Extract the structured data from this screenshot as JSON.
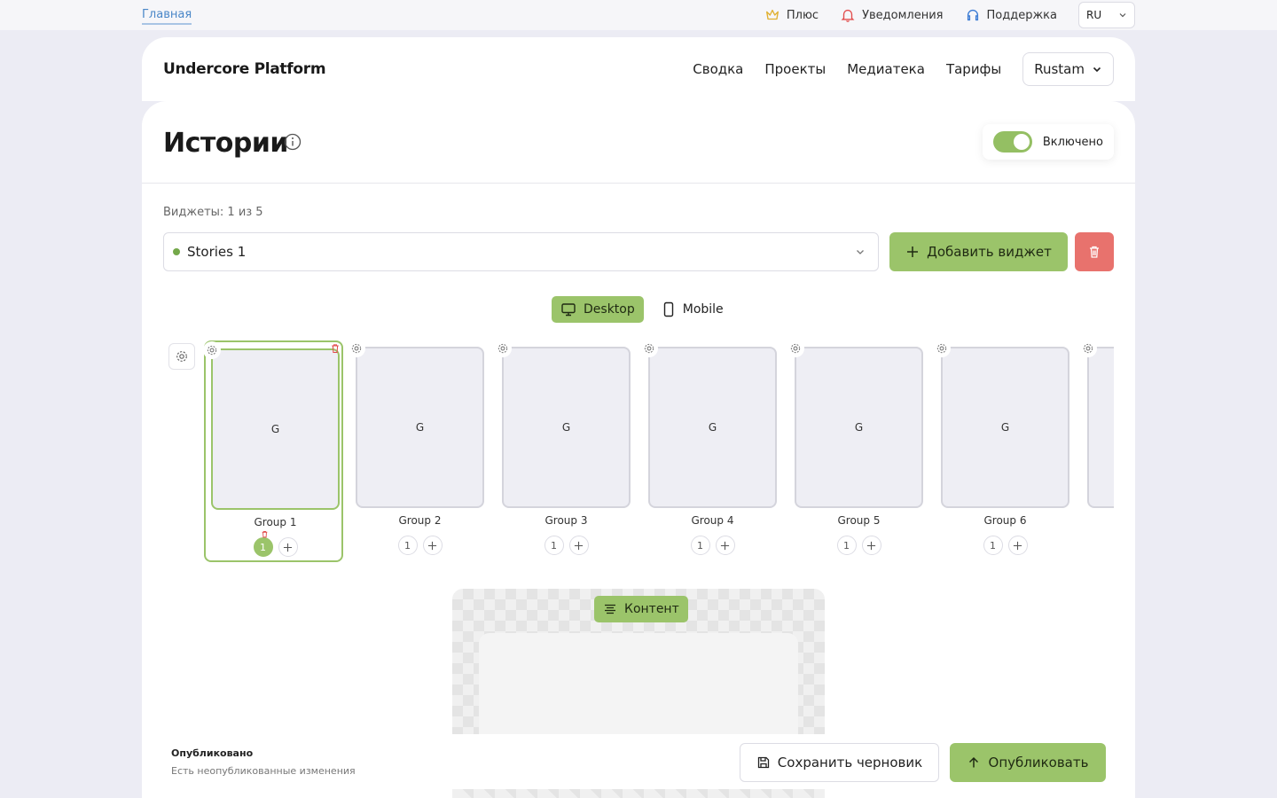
{
  "topbar": {
    "home": "Главная",
    "links": [
      {
        "label": "Плюс",
        "icon": "crown-icon"
      },
      {
        "label": "Уведомления",
        "icon": "bell-icon"
      },
      {
        "label": "Поддержка",
        "icon": "headset-icon"
      }
    ],
    "lang": "RU"
  },
  "header": {
    "logo": "Undercore Platform",
    "nav": [
      "Сводка",
      "Проекты",
      "Медиатека",
      "Тарифы"
    ],
    "user": "Rustam"
  },
  "page": {
    "title": "Истории",
    "toggle_label": "Включено",
    "widgets_count": "Виджеты: 1 из 5",
    "selected_widget": "Stories 1",
    "add_widget": "Добавить виджет",
    "device_desktop": "Desktop",
    "device_mobile": "Mobile",
    "content_btn": "Контент"
  },
  "groups": [
    {
      "label": "Group 1",
      "thumb": "G",
      "story": "1"
    },
    {
      "label": "Group 2",
      "thumb": "G",
      "story": "1"
    },
    {
      "label": "Group 3",
      "thumb": "G",
      "story": "1"
    },
    {
      "label": "Group 4",
      "thumb": "G",
      "story": "1"
    },
    {
      "label": "Group 5",
      "thumb": "G",
      "story": "1"
    },
    {
      "label": "Group 6",
      "thumb": "G",
      "story": "1"
    }
  ],
  "footer": {
    "status": "Опубликовано",
    "sub": "Есть неопубликованные изменения",
    "save": "Сохранить черновик",
    "publish": "Опубликовать"
  },
  "colors": {
    "accent": "#9bc46a",
    "danger": "#e8726d",
    "link": "#4a87c8"
  }
}
